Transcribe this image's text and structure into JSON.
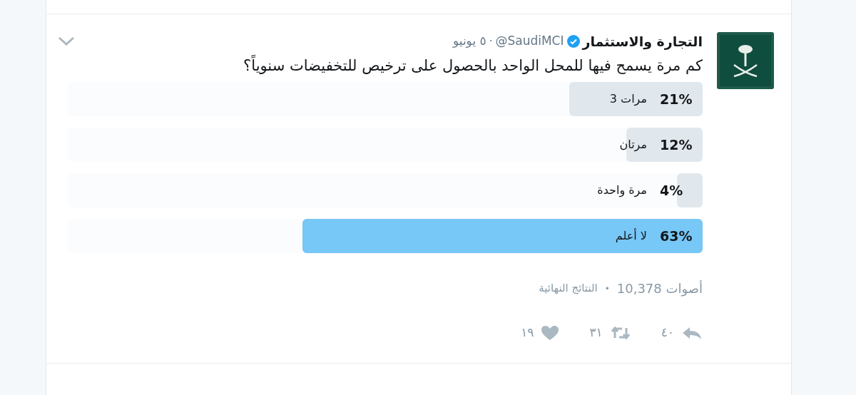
{
  "tweet": {
    "author_name": "التجارة والاستثمار",
    "verified": true,
    "handle": "@SaudiMCI",
    "separator": "·",
    "date": "٥ يونيو",
    "text": "كم مرة يسمح فيها للمحل الواحد بالحصول على ترخيص للتخفيضات سنوياً؟"
  },
  "poll": {
    "options": [
      {
        "percent": "21%",
        "label": "مرات 3",
        "level": 0.21,
        "leading": false
      },
      {
        "percent": "12%",
        "label": "مرتان",
        "level": 0.12,
        "leading": false
      },
      {
        "percent": "4%",
        "label": "مرة واحدة",
        "level": 0.04,
        "leading": false
      },
      {
        "percent": "63%",
        "label": "لا أعلم",
        "level": 0.63,
        "leading": true
      }
    ],
    "votes": "أصوات 10,378",
    "dot": "•",
    "status": "النتائج النهائية"
  },
  "actions": [
    {
      "kind": "reply",
      "count": "٤٠"
    },
    {
      "kind": "retweet",
      "count": "٣١"
    },
    {
      "kind": "like",
      "count": "١٩"
    }
  ]
}
